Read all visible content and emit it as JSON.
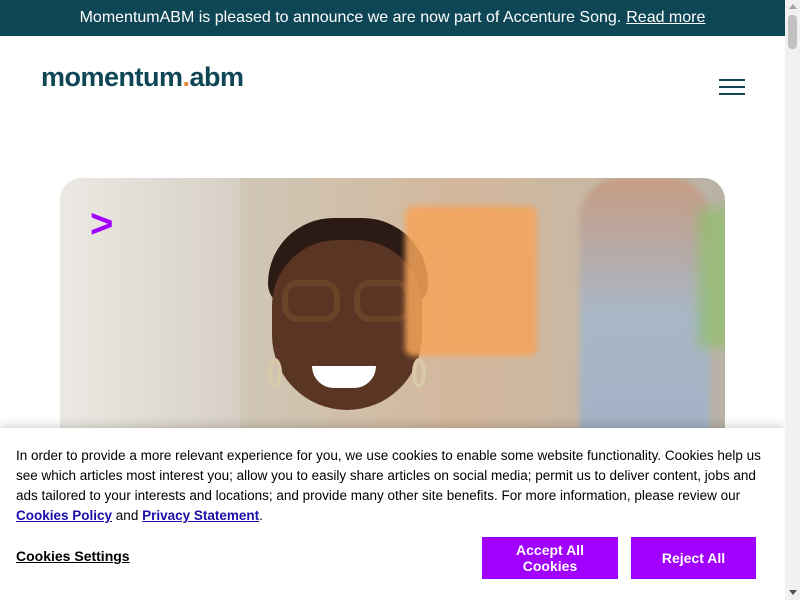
{
  "announcement": {
    "message": "MomentumABM is pleased to announce we are now part of Accenture Song.",
    "link_label": "Read more"
  },
  "header": {
    "logo_main": "momentum",
    "logo_dot": ".",
    "logo_suffix": "abm",
    "menu_icon": "hamburger-menu-icon"
  },
  "hero": {
    "accent_mark": ">",
    "image_description_icon": "hero-photo"
  },
  "cookie_banner": {
    "text_part1": "In order to provide a more relevant experience for you, we use cookies to enable some website functionality. Cookies help us see which articles most interest you; allow you to easily share articles on social media; permit us to deliver content, jobs and ads tailored to your interests and locations; and provide many other site benefits. For more information, please review our ",
    "cookies_policy_link": "Cookies Policy",
    "and_text": " and ",
    "privacy_link": "Privacy Statement",
    "period": ".",
    "settings_label": "Cookies Settings",
    "accept_label": "Accept All Cookies",
    "reject_label": "Reject All"
  },
  "colors": {
    "brand_dark": "#0e4655",
    "accent_purple": "#a100ff",
    "logo_dot": "#e98b3a"
  }
}
